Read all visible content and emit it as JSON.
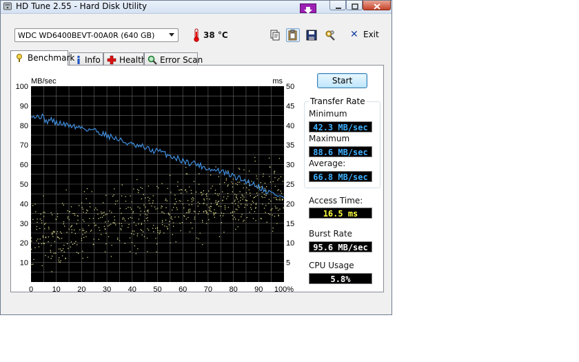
{
  "window": {
    "title": "HD Tune 2.55 - Hard Disk Utility"
  },
  "toolbar": {
    "drive": "WDC WD6400BEVT-00A0R (640 GB)",
    "temperature": "38 °C",
    "exit_label": "Exit"
  },
  "tabs": [
    {
      "label": "Benchmark",
      "icon": "benchmark-icon",
      "active": true
    },
    {
      "label": "Info",
      "icon": "info-icon",
      "active": false
    },
    {
      "label": "Health",
      "icon": "health-icon",
      "active": false
    },
    {
      "label": "Error Scan",
      "icon": "magnifier-icon",
      "active": false
    }
  ],
  "benchmark": {
    "start_label": "Start",
    "transfer_rate_title": "Transfer Rate",
    "minimum_label": "Minimum",
    "minimum_value": "42.3 MB/sec",
    "maximum_label": "Maximum",
    "maximum_value": "88.6 MB/sec",
    "average_label": "Average:",
    "average_value": "66.8 MB/sec",
    "access_time_label": "Access Time:",
    "access_time_value": "16.5 ms",
    "burst_rate_label": "Burst Rate",
    "burst_rate_value": "95.6 MB/sec",
    "cpu_usage_label": "CPU Usage",
    "cpu_usage_value": "5.8%"
  },
  "colors": {
    "chart_bg": "#000000",
    "grid": "#6a6a6a",
    "transfer_line": "#3f8ede",
    "access_points": "#d8d88a",
    "readout_blue_text": "#3fb0ff",
    "readout_yellow_text": "#ffff40",
    "readout_white_text": "#ffffff"
  },
  "chart_data": {
    "type": "line",
    "ylabel_left": "MB/sec",
    "ylabel_right": "ms",
    "ylim_left": [
      0,
      100
    ],
    "ylim_right": [
      0,
      50
    ],
    "xlim": [
      0,
      100
    ],
    "x_ticks": [
      "0",
      "10",
      "20",
      "30",
      "40",
      "50",
      "60",
      "70",
      "80",
      "90",
      "100%"
    ],
    "y_ticks_left": [
      "10",
      "20",
      "30",
      "40",
      "50",
      "60",
      "70",
      "80",
      "90",
      "100"
    ],
    "y_ticks_right": [
      "5",
      "10",
      "15",
      "20",
      "25",
      "30",
      "35",
      "40",
      "45",
      "50"
    ],
    "grid": true,
    "series": [
      {
        "kind": "transfer_rate",
        "x": [
          0,
          2,
          4,
          6,
          8,
          10,
          12,
          14,
          16,
          18,
          20,
          22,
          24,
          26,
          28,
          30,
          32,
          34,
          36,
          38,
          40,
          42,
          44,
          46,
          48,
          50,
          52,
          54,
          56,
          58,
          60,
          62,
          64,
          66,
          68,
          70,
          72,
          74,
          76,
          78,
          80,
          82,
          84,
          86,
          88,
          90,
          92,
          94,
          96,
          98,
          100
        ],
        "values": [
          86,
          84,
          85,
          82,
          83,
          81,
          81,
          80,
          80,
          79,
          79,
          78,
          78,
          77,
          76,
          75,
          74,
          73,
          72,
          71,
          70,
          69,
          69,
          68,
          67,
          67,
          66,
          65,
          64,
          63,
          62,
          61,
          61,
          60,
          59,
          58,
          57,
          57,
          56,
          55,
          54,
          53,
          52,
          51,
          50,
          49,
          47,
          46,
          45,
          44,
          43
        ]
      },
      {
        "kind": "access_time",
        "unit": "ms",
        "trend_x": [
          0,
          100
        ],
        "trend_values": [
          12,
          23
        ],
        "spread": 6
      }
    ]
  }
}
